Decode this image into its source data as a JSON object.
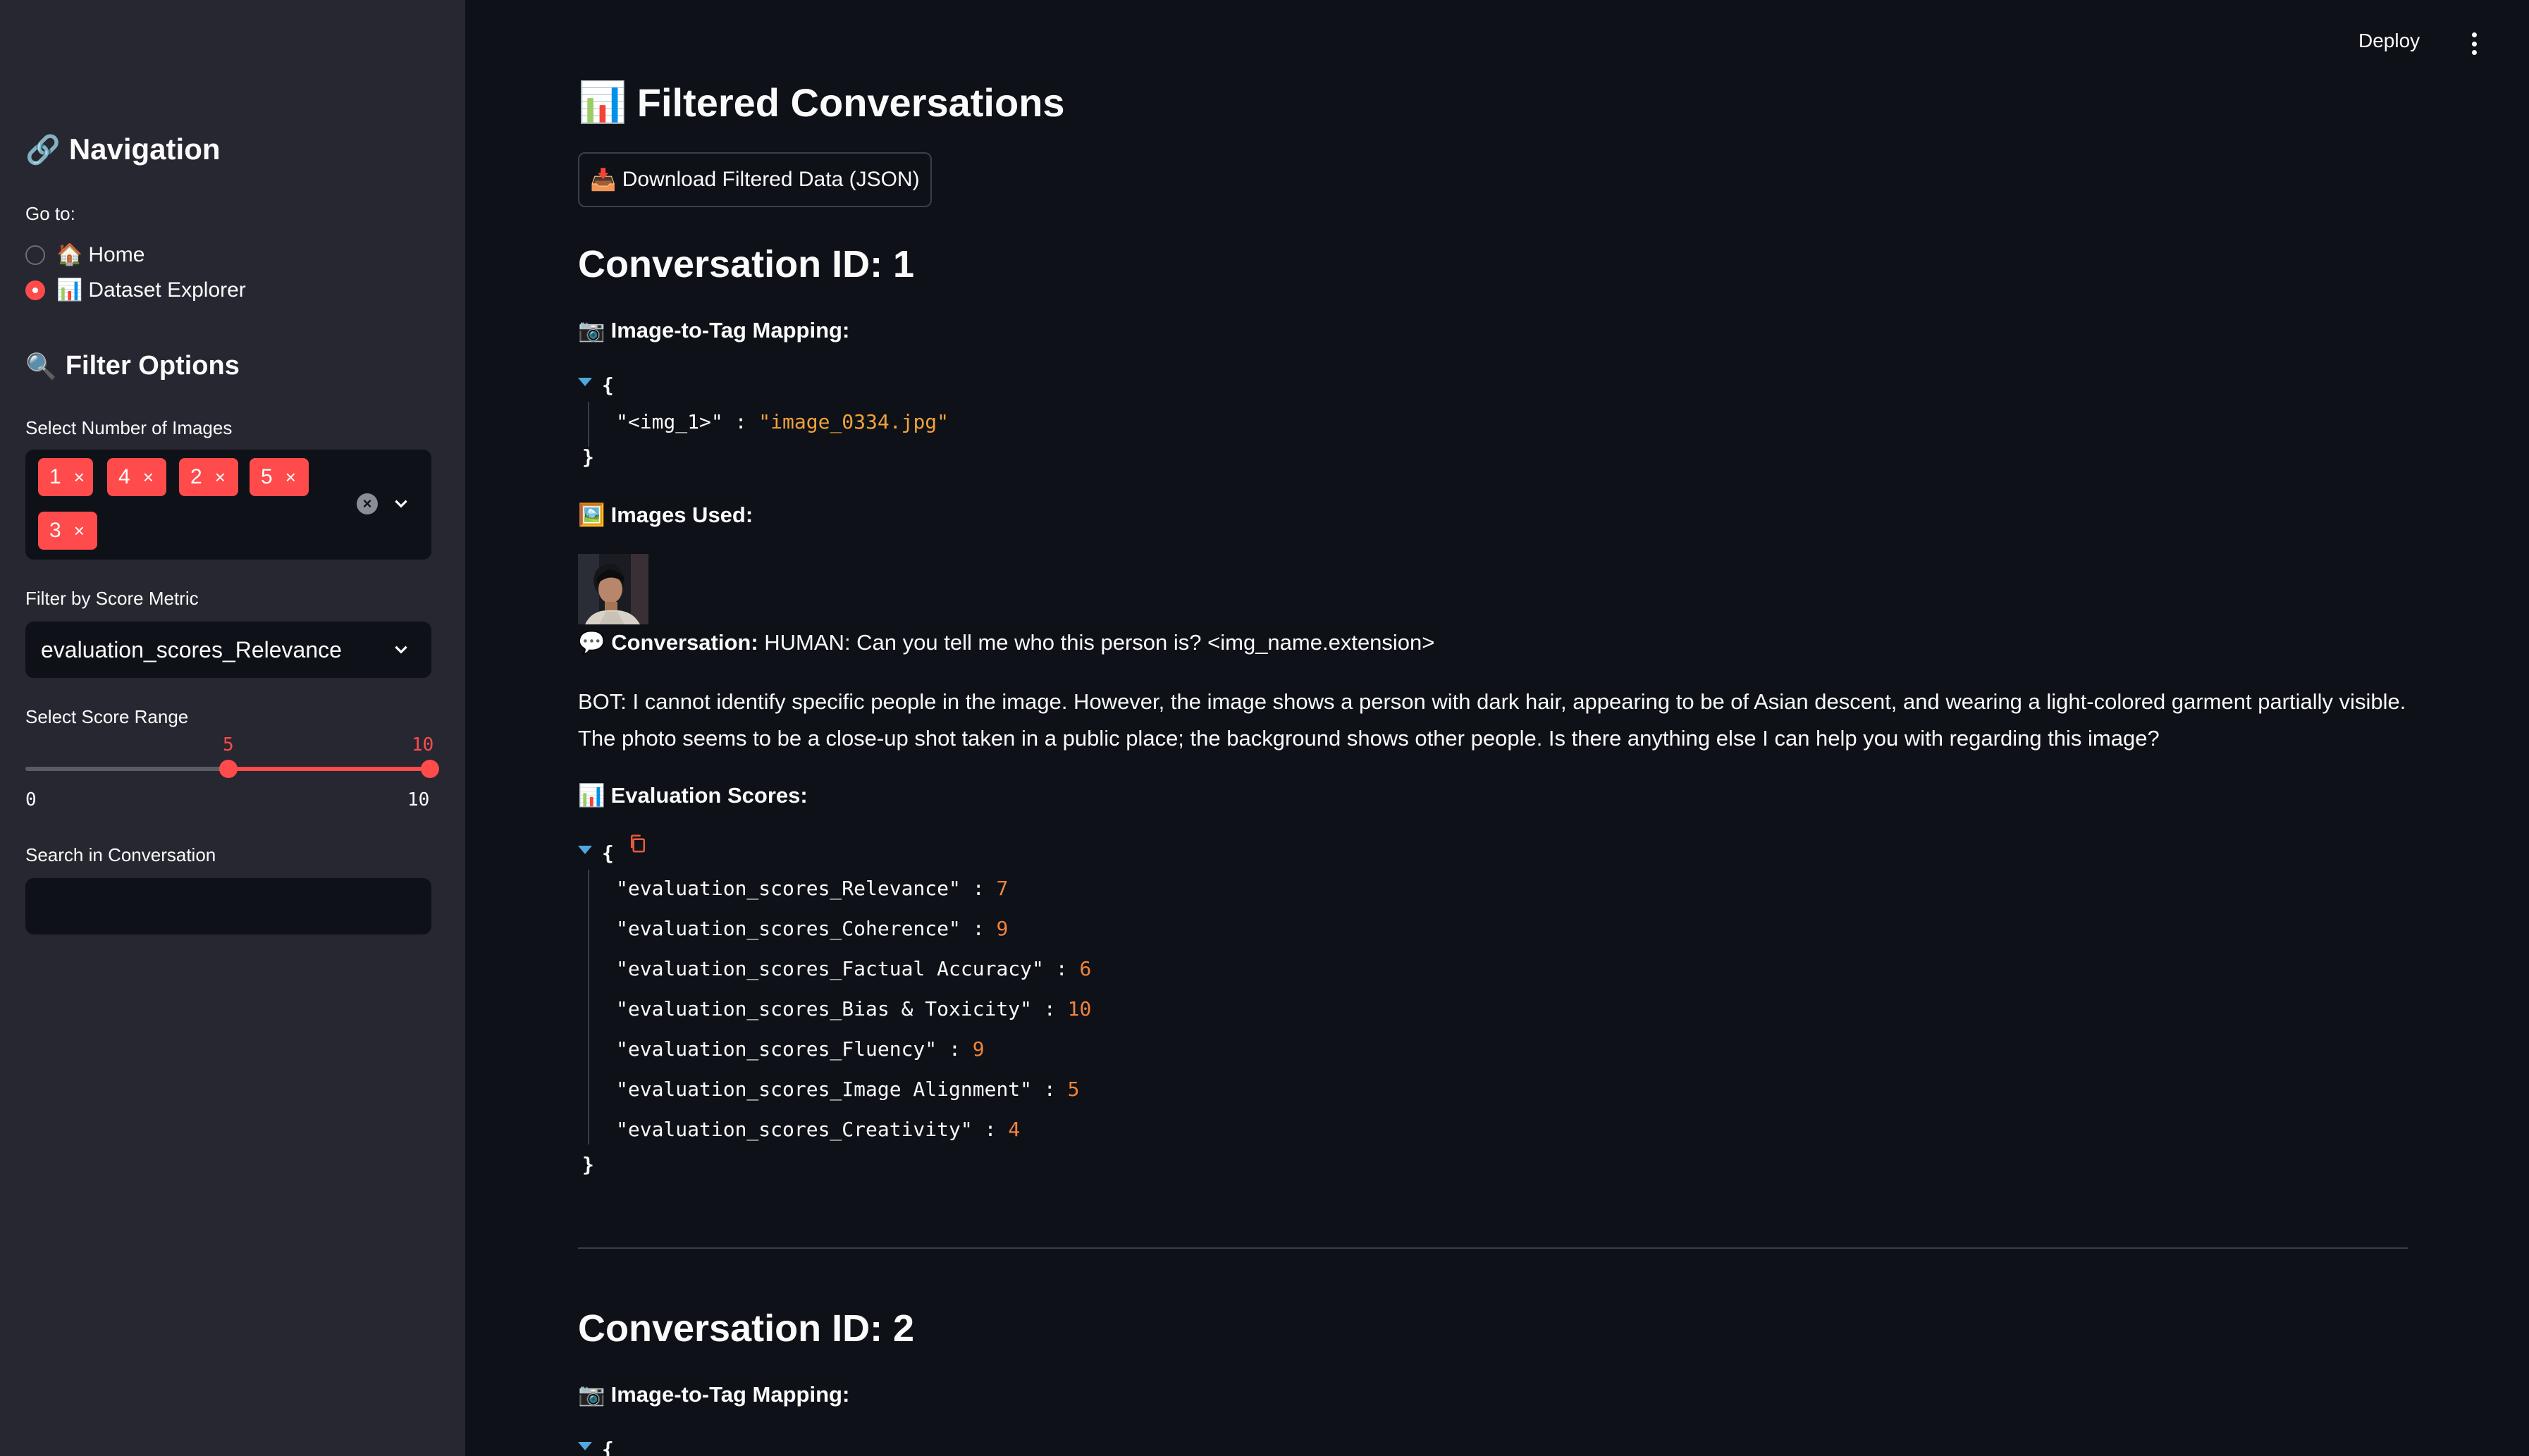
{
  "sidebar": {
    "nav_title": "Navigation",
    "nav_icon": "🔗",
    "goto_label": "Go to:",
    "radio_options": [
      {
        "icon": "🏠",
        "label": "Home",
        "selected": false
      },
      {
        "icon": "📊",
        "label": "Dataset Explorer",
        "selected": true
      }
    ],
    "filter_title": "Filter Options",
    "filter_icon": "🔍",
    "num_images_label": "Select Number of Images",
    "num_images_selected": [
      "1",
      "4",
      "2",
      "5",
      "3"
    ],
    "chip_remove": "×",
    "score_metric_label": "Filter by Score Metric",
    "score_metric_value": "evaluation_scores_Relevance",
    "score_range_label": "Select Score Range",
    "score_range": {
      "min": 0,
      "max": 10,
      "low": 5,
      "high": 10
    },
    "score_range_low_text": "5",
    "score_range_high_text": "10",
    "score_range_min_text": "0",
    "score_range_max_text": "10",
    "search_label": "Search in Conversation",
    "search_value": ""
  },
  "header": {
    "deploy_label": "Deploy"
  },
  "main": {
    "title_icon": "📊",
    "title": "Filtered Conversations",
    "download_icon": "📥",
    "download_label": "Download Filtered Data (JSON)",
    "conversations": [
      {
        "id_heading": "Conversation ID: 1",
        "mapping_icon": "📷",
        "mapping_label": "Image-to-Tag Mapping:",
        "mapping": [
          {
            "key": "\"<img_1>\"",
            "value": "\"image_0334.jpg\""
          }
        ],
        "images_icon": "🖼️",
        "images_label": "Images Used:",
        "conversation_icon": "💬",
        "conversation_label": "Conversation:",
        "human_text": "HUMAN: Can you tell me who this person is? <img_name.extension>",
        "bot_text": "BOT: I cannot identify specific people in the image. However, the image shows a person with dark hair, appearing to be of Asian descent, and wearing a light-colored garment partially visible. The photo seems to be a close-up shot taken in a public place; the background shows other people. Is there anything else I can help you with regarding this image?",
        "scores_icon": "📊",
        "scores_label": "Evaluation Scores:",
        "scores": [
          {
            "key": "\"evaluation_scores_Relevance\"",
            "value": "7"
          },
          {
            "key": "\"evaluation_scores_Coherence\"",
            "value": "9"
          },
          {
            "key": "\"evaluation_scores_Factual Accuracy\"",
            "value": "6"
          },
          {
            "key": "\"evaluation_scores_Bias & Toxicity\"",
            "value": "10"
          },
          {
            "key": "\"evaluation_scores_Fluency\"",
            "value": "9"
          },
          {
            "key": "\"evaluation_scores_Image Alignment\"",
            "value": "5"
          },
          {
            "key": "\"evaluation_scores_Creativity\"",
            "value": "4"
          }
        ]
      },
      {
        "id_heading": "Conversation ID: 2",
        "mapping_icon": "📷",
        "mapping_label": "Image-to-Tag Mapping:"
      }
    ],
    "json_open": "{",
    "json_close": "}",
    "json_sep": " : "
  },
  "colors": {
    "accent": "#ff4b4b",
    "background": "#0e1117",
    "sidebar": "#262730",
    "json_string": "#f1a23c"
  }
}
